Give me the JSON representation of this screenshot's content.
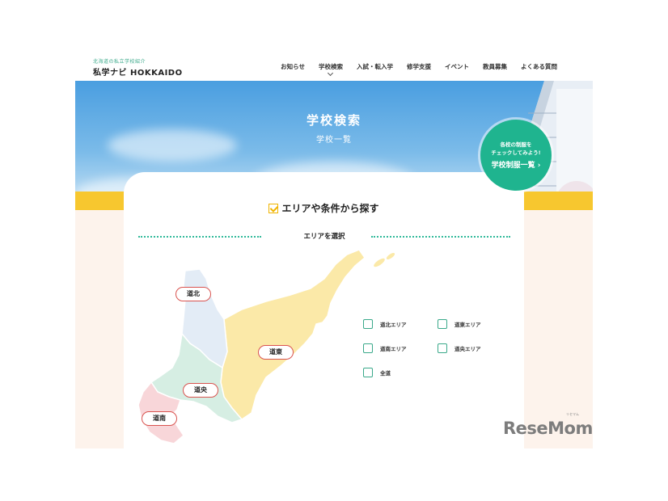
{
  "header": {
    "logo_sub": "北海道の私立学校紹介",
    "logo_main": "私学ナビ HOKKAIDO",
    "nav": [
      {
        "label": "お知らせ"
      },
      {
        "label": "学校検索"
      },
      {
        "label": "入試・転入学"
      },
      {
        "label": "修学支援"
      },
      {
        "label": "イベント"
      },
      {
        "label": "教員募集"
      },
      {
        "label": "よくある質問"
      }
    ]
  },
  "hero": {
    "title": "学校検索",
    "subtitle": "学校一覧"
  },
  "uniform_badge": {
    "line1": "各校の制服を",
    "line2": "チェックしてみよう!",
    "line3": "学校制服一覧 ›"
  },
  "search": {
    "heading": "エリアや条件から探す",
    "area_select_label": "エリアを選択"
  },
  "map": {
    "regions": [
      {
        "label": "道北",
        "color": "#e3ecf6"
      },
      {
        "label": "道東",
        "color": "#fbe9a8"
      },
      {
        "label": "道央",
        "color": "#d6eee3"
      },
      {
        "label": "道南",
        "color": "#f8d6d9"
      }
    ]
  },
  "area_checkboxes": [
    {
      "label": "道北エリア",
      "checked": false
    },
    {
      "label": "道東エリア",
      "checked": false
    },
    {
      "label": "道南エリア",
      "checked": false
    },
    {
      "label": "道央エリア",
      "checked": false
    },
    {
      "label": "全道",
      "checked": false
    }
  ],
  "watermark": {
    "text": "ReseMom",
    "ruby": "リセマム"
  },
  "colors": {
    "accent_green": "#1fb48f",
    "accent_yellow": "#f7c72f",
    "region_border_red": "#d9534f"
  }
}
